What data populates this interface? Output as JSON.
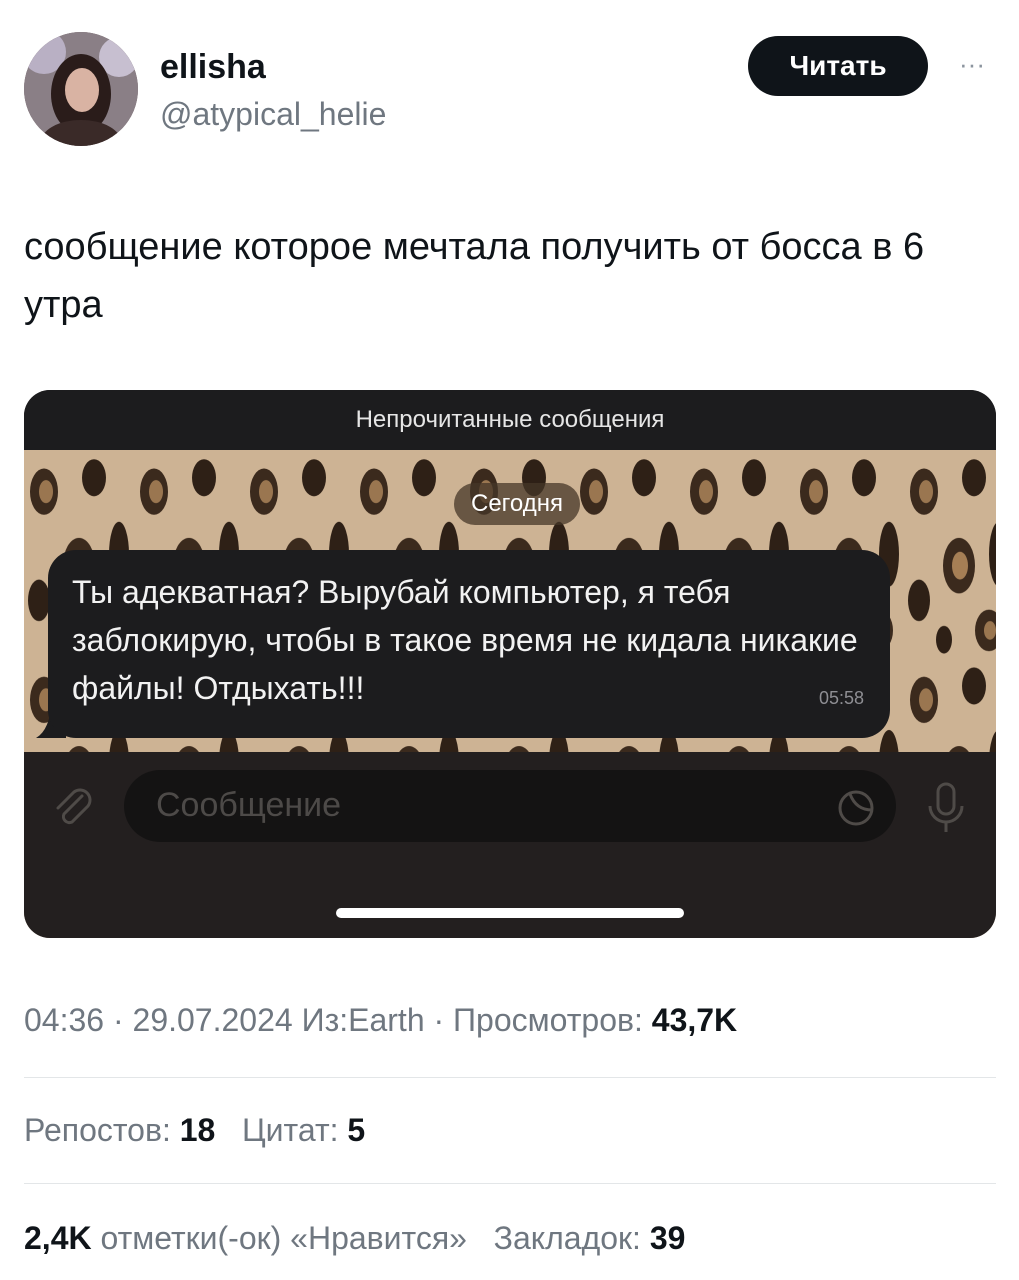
{
  "author": {
    "display_name": "ellisha",
    "handle": "@atypical_helie"
  },
  "follow_button": {
    "label": "Читать"
  },
  "more_button": {
    "label": "···"
  },
  "tweet": {
    "text": "сообщение которое мечтала получить от босса в 6 утра"
  },
  "screenshot": {
    "unread_banner": "Непрочитанные сообщения",
    "date_chip": "Сегодня",
    "message": {
      "text": "Ты адекватная? Вырубай компьютер, я тебя заблокирую, чтобы в такое время не кидала никакие файлы! Отдыхать!!!",
      "time": "05:58"
    },
    "input_placeholder": "Сообщение"
  },
  "meta": {
    "time": "04:36",
    "date": "29.07.2024",
    "source": "Из:Earth",
    "views_label": "Просмотров:",
    "views_value": "43,7K"
  },
  "stats": {
    "reposts_label": "Репостов:",
    "reposts_value": "18",
    "quotes_label": "Цитат:",
    "quotes_value": "5",
    "likes_value": "2,4K",
    "likes_label": "отметки(-ок) «Нравится»",
    "bookmarks_label": "Закладок:",
    "bookmarks_value": "39"
  },
  "colors": {
    "primary_text": "#0f1419",
    "secondary_text": "#6f7780",
    "chat_bubble": "#1c1c1e"
  }
}
